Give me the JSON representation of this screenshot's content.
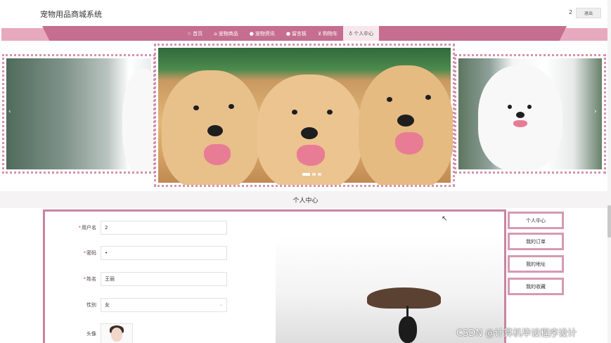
{
  "header": {
    "site_title": "宠物用品商城系统",
    "user_count": "2",
    "logout_label": "退出"
  },
  "nav": {
    "items": [
      {
        "icon": "☆",
        "label": "首页"
      },
      {
        "icon": "⌂",
        "label": "宠物商品"
      },
      {
        "icon": "●",
        "label": "宠物资讯"
      },
      {
        "icon": "●",
        "label": "留言板"
      },
      {
        "icon": "⊻",
        "label": "购物车"
      },
      {
        "icon": "♁",
        "label": "个人中心"
      }
    ],
    "active_index": 5
  },
  "carousel": {
    "prev_icon": "‹",
    "next_icon": "›"
  },
  "section": {
    "title": "个人中心"
  },
  "form": {
    "username_label": "用户名",
    "username_value": "2",
    "password_label": "密码",
    "password_value": "•",
    "name_label": "姓名",
    "name_value": "王丽",
    "gender_label": "性别",
    "gender_value": "女",
    "avatar_label": "头像",
    "required_mark": "*"
  },
  "side_menu": {
    "items": [
      "个人中心",
      "我的订单",
      "我的地址",
      "我的收藏"
    ]
  },
  "watermark": "CSDN @计算机毕设程序设计",
  "colors": {
    "nav_bar": "#c56e8f",
    "nav_band": "#e7a9bd",
    "accent_border": "#d592ab",
    "required": "#e04848"
  }
}
